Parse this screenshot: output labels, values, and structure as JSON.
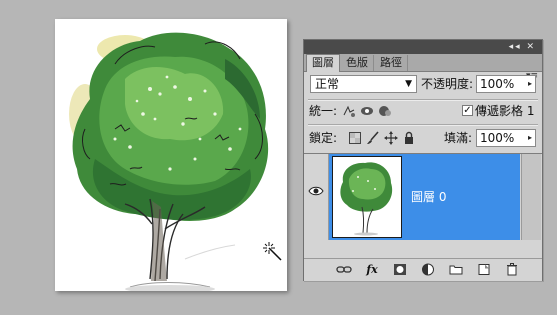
{
  "panel": {
    "title_icons": "◂◂ ✕",
    "tabs": [
      {
        "label": "圖層"
      },
      {
        "label": "色版"
      },
      {
        "label": "路徑"
      }
    ],
    "menu_icon": "▾≡",
    "blend_mode": "正常",
    "opacity_label": "不透明度:",
    "opacity_value": "100%",
    "unify_label": "統一:",
    "propagate_label": "傳遞影格 1",
    "propagate_checked": "✓",
    "lock_label": "鎖定:",
    "fill_label": "填滿:",
    "fill_value": "100%",
    "layer": {
      "name": "圖層 0",
      "visible": true
    },
    "footer_icons": [
      "link-icon",
      "fx-icon",
      "mask-icon",
      "adjustment-icon",
      "folder-icon",
      "new-layer-icon",
      "trash-icon"
    ],
    "fx_label": "fx"
  },
  "colors": {
    "selection": "#3d8ee8",
    "panel_bg": "#d4d4d4",
    "workspace": "#b6b6b6",
    "titlebar": "#4a4a4a"
  }
}
